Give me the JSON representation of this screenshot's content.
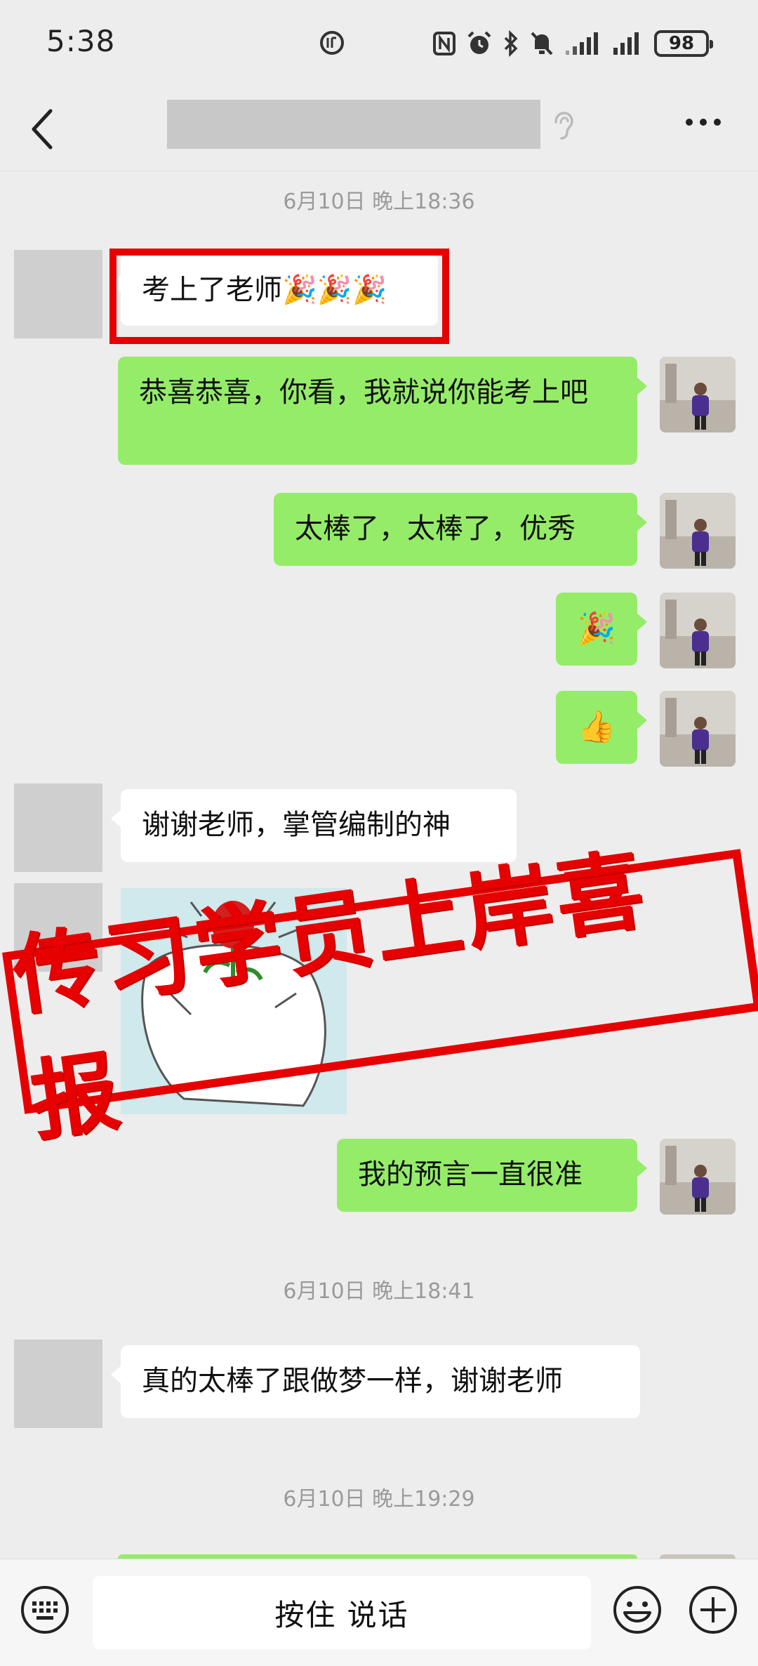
{
  "status_bar": {
    "time": "5:38",
    "battery": "98",
    "icons": [
      "data-icon",
      "nfc-icon",
      "alarm-icon",
      "bluetooth-icon",
      "mute-icon",
      "signal-icon",
      "signal-icon",
      "battery-icon"
    ]
  },
  "nav": {
    "back_icon": "chevron-left-icon",
    "title": "",
    "listen_icon": "ear-icon",
    "more_icon": "more-dots-icon"
  },
  "messages": {
    "ts1": "6月10日 晚上18:36",
    "m1": "考上了老师🎉🎉🎉",
    "m2": "恭喜恭喜，你看，我就说你能考上吧",
    "m3": "太棒了，太棒了，优秀",
    "m4": "🎉",
    "m5": "👍",
    "m6": "谢谢老师，掌管编制的神",
    "m8": "我的预言一直很准",
    "ts2": "6月10日 晚上18:41",
    "m9": "真的太棒了跟做梦一样，谢谢老师",
    "ts3": "6月10日 晚上19:29"
  },
  "stamp": {
    "text": "传习学员上岸喜报"
  },
  "input_bar": {
    "talk_label": "按住 说话",
    "icons": [
      "keyboard-icon",
      "emoji-icon",
      "plus-icon"
    ]
  },
  "colors": {
    "background": "#ededed",
    "outgoing_bubble": "#95ec69",
    "incoming_bubble": "#ffffff",
    "highlight_red": "#e60000",
    "timestamp": "#9a9a9a"
  }
}
